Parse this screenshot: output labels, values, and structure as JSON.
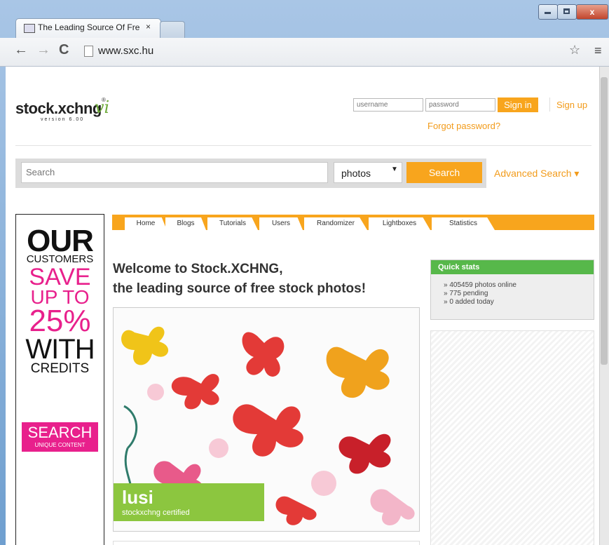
{
  "browser": {
    "tab_title": "The Leading Source Of Fre",
    "tab_close": "×",
    "url": "www.sxc.hu",
    "back": "←",
    "forward": "→",
    "reload": "C",
    "star": "☆",
    "menu": "≡",
    "minimize": "–",
    "maximize": "□",
    "close": "x"
  },
  "header": {
    "logo": "stock.xchng",
    "logo_vi": "vi",
    "version": "version 6.00",
    "username_placeholder": "username",
    "password_placeholder": "password",
    "signin": "Sign in",
    "signup": "Sign up",
    "forgot": "Forgot password?"
  },
  "search": {
    "placeholder": "Search",
    "type_selected": "photos",
    "button": "Search",
    "advanced": "Advanced Search ▾"
  },
  "ad": {
    "line1": "OUR",
    "line2": "CUSTOMERS",
    "line3": "SAVE",
    "line4": "UP TO",
    "line5": "25%",
    "line6": "WITH",
    "line7": "CREDITS",
    "cta": "SEARCH",
    "cta_sub": "UNIQUE CONTENT"
  },
  "nav": {
    "tabs": [
      "Home",
      "Blogs",
      "Tutorials",
      "Users",
      "Randomizer",
      "Lightboxes",
      "Statistics"
    ]
  },
  "main": {
    "welcome_line1": "Welcome to Stock.XCHNG,",
    "welcome_line2": "the leading source of free stock photos!",
    "badge_title": "lusi",
    "badge_sub": "stockxchng certified"
  },
  "quick_stats": {
    "title": "Quick stats",
    "photos_online": "» 405459 photos online",
    "pending": "» 775 pending",
    "added_today": "» 0 added today"
  },
  "colors": {
    "accent_orange": "#f8a51d",
    "green": "#57b84a",
    "ad_pink": "#e8208c"
  }
}
